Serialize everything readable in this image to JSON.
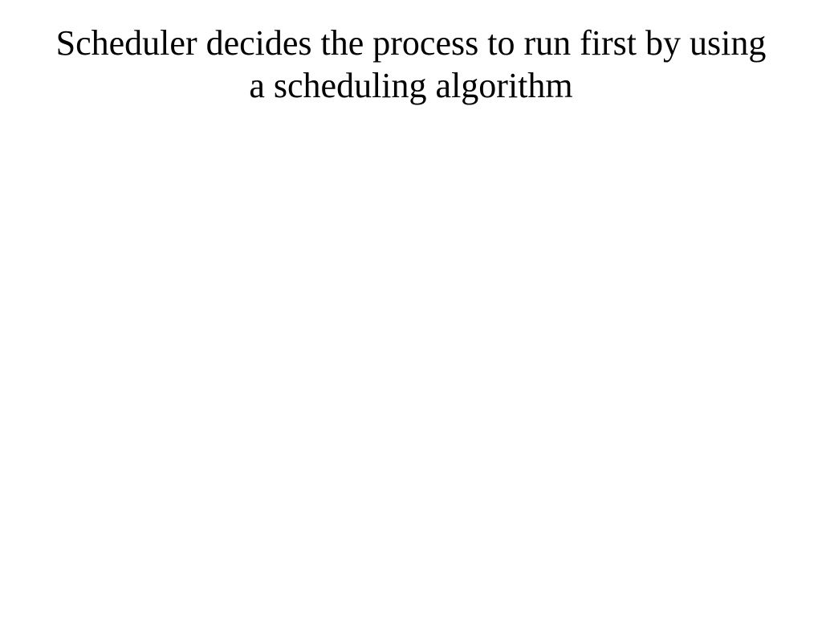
{
  "slide": {
    "title": "Scheduler decides the process to run first by using a scheduling algorithm"
  }
}
